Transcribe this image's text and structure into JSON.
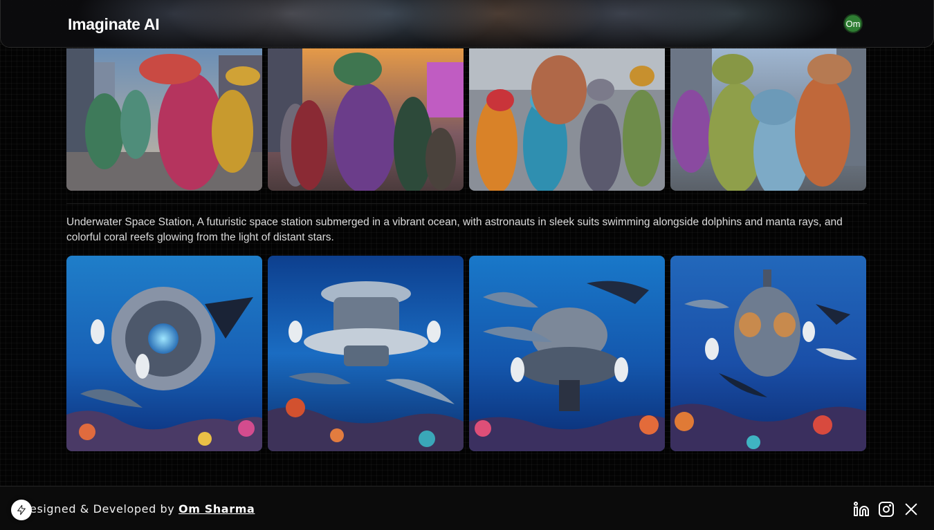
{
  "header": {
    "logo": "Imaginate AI",
    "avatar_initials": "Om",
    "avatar_color": "#2e7d32"
  },
  "gallery": [
    {
      "prompt": "",
      "images": [
        {
          "subject": "cartoon dinosaurs in hoodies on city street"
        },
        {
          "subject": "dinosaurs in jackets wearing sunglasses at sunset city"
        },
        {
          "subject": "young dinosaurs with backpacks and sunglasses"
        },
        {
          "subject": "roaring dinosaurs in city plaza"
        }
      ]
    },
    {
      "prompt": "Underwater Space Station, A futuristic space station submerged in a vibrant ocean, with astronauts in sleek suits swimming alongside dolphins and manta rays, and colorful coral reefs glowing from the light of distant stars.",
      "images": [
        {
          "subject": "round space station with astronauts and dolphins"
        },
        {
          "subject": "saucer shaped station with astronauts and dolphins"
        },
        {
          "subject": "dome station with astronauts, dolphins and manta ray"
        },
        {
          "subject": "capsule station with dolphins and manta ray"
        }
      ]
    }
  ],
  "footer": {
    "text_prefix": "esigned & Developed by ",
    "author": "Om Sharma",
    "icons": [
      "linkedin-icon",
      "instagram-icon",
      "x-icon"
    ]
  },
  "colors": {
    "background": "#030303",
    "accent": "#2e7d32"
  }
}
